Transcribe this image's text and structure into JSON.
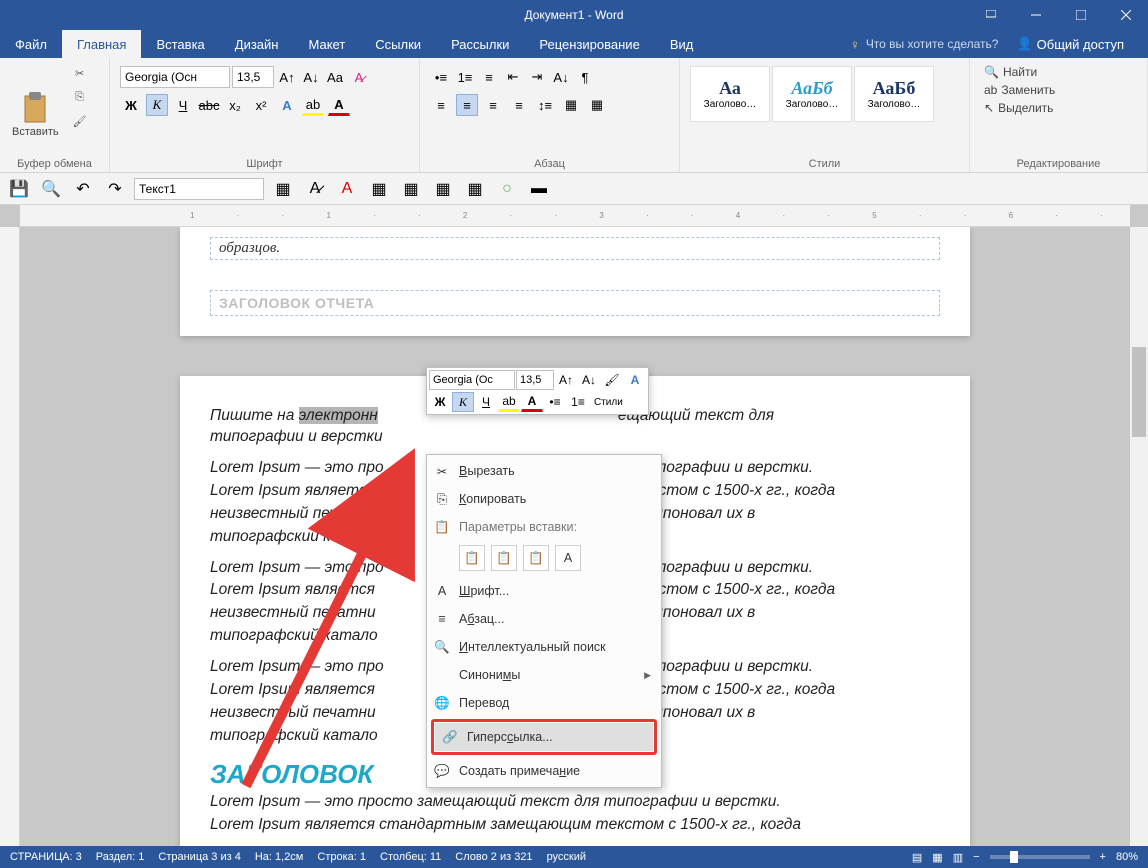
{
  "window": {
    "title": "Документ1 - Word"
  },
  "tabs": {
    "file": "Файл",
    "home": "Главная",
    "insert": "Вставка",
    "design": "Дизайн",
    "layout": "Макет",
    "references": "Ссылки",
    "mailings": "Рассылки",
    "review": "Рецензирование",
    "view": "Вид",
    "tellme": "Что вы хотите сделать?",
    "share": "Общий доступ"
  },
  "ribbon": {
    "clipboard": {
      "label": "Буфер обмена",
      "paste": "Вставить"
    },
    "font": {
      "label": "Шрифт",
      "name": "Georgia (Осн",
      "size": "13,5",
      "bold": "Ж",
      "italic": "К",
      "underline": "Ч",
      "strike": "abc",
      "sub": "x₂",
      "sup": "x²"
    },
    "para": {
      "label": "Абзац"
    },
    "styles": {
      "label": "Стили",
      "items": [
        "Заголово…",
        "Заголово…",
        "Заголово…"
      ],
      "preview": [
        "Аа",
        "АаБб",
        "АаБб"
      ]
    },
    "editing": {
      "label": "Редактирование",
      "find": "Найти",
      "replace": "Заменить",
      "select": "Выделить"
    }
  },
  "qat": {
    "style": "Текст1"
  },
  "doc": {
    "sample1": "образцов.",
    "report": "ЗАГОЛОВОК ОТЧЕТА",
    "p1a": "Пишите на ",
    "p1sel": "электронн",
    "p1b": "ещающий текст для",
    "p1c": "типографии и верстки",
    "p2a": "Lorem Ipsum — это про",
    "p2b": "я типографии и верстки.",
    "p3a": "Lorem Ipsum является",
    "p3b": "м текстом с 1500-х гг., когда",
    "p4a": "неизвестный печатни",
    "p4b": "и скомпоновал их в",
    "p5": "типографский катало",
    "h2": "ЗАГОЛОВОК",
    "p6": "Lorem Ipsum — это просто замещающий текст для типографии и верстки.",
    "p7": "Lorem Ipsum является стандартным замещающим текстом с 1500-х гг., когда"
  },
  "minitoolbar": {
    "font": "Georgia (Ос",
    "size": "13,5",
    "styles": "Стили"
  },
  "ctx": {
    "cut": "Вырезать",
    "copy": "Копировать",
    "pasteopts": "Параметры вставки:",
    "font": "Шрифт...",
    "para": "Абзац...",
    "smart": "Интеллектуальный поиск",
    "synonyms": "Синонимы",
    "translate": "Перевод",
    "hyperlink": "Гиперссылка...",
    "comment": "Создать примечание"
  },
  "status": {
    "page": "СТРАНИЦА: 3",
    "section": "Раздел: 1",
    "pageof": "Страница 3 из 4",
    "at": "На: 1,2см",
    "line": "Строка: 1",
    "col": "Столбец: 11",
    "words": "Слово 2 из 321",
    "lang": "русский",
    "zoom": "80%"
  }
}
